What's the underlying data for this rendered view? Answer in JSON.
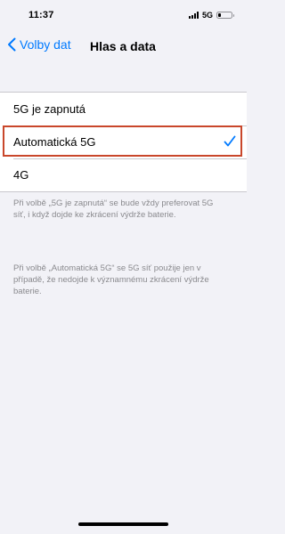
{
  "status_bar": {
    "time": "11:37",
    "network": "5G",
    "battery_level": 0.2,
    "signal_bars": 4
  },
  "nav": {
    "back_label": "Volby dat",
    "title": "Hlas a data"
  },
  "options": [
    {
      "label": "5G je zapnutá",
      "selected": false
    },
    {
      "label": "Automatická 5G",
      "selected": true
    },
    {
      "label": "4G",
      "selected": false
    }
  ],
  "footnotes": [
    "Při volbě „5G je zapnutá“ se bude vždy preferovat 5G síť, i když dojde ke zkrácení výdrže baterie.",
    "Při volbě „Automatická 5G“ se 5G síť použije jen v případě, že nedojde k významnému zkrácení výdrže baterie."
  ],
  "colors": {
    "accent": "#007aff",
    "highlight": "#c9472b",
    "background": "#f2f2f7"
  }
}
